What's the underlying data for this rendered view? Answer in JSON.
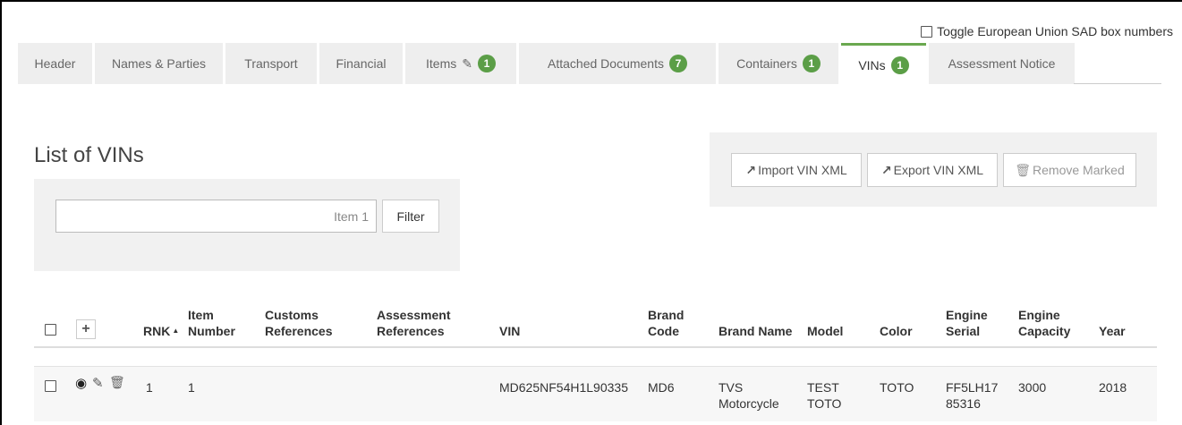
{
  "toggle": {
    "label": "Toggle European Union SAD box numbers"
  },
  "tabs": [
    {
      "label": "Header"
    },
    {
      "label": "Names & Parties"
    },
    {
      "label": "Transport"
    },
    {
      "label": "Financial"
    },
    {
      "label": "Items",
      "badge": "1",
      "icon": "edit-icon"
    },
    {
      "label": "Attached Documents",
      "badge": "7"
    },
    {
      "label": "Containers",
      "badge": "1"
    },
    {
      "label": "VINs",
      "badge": "1",
      "active": true
    },
    {
      "label": "Assessment Notice"
    }
  ],
  "list": {
    "title": "List of VINs",
    "filter_value": "Item 1",
    "filter_button": "Filter"
  },
  "actions": {
    "import_label": "Import VIN XML",
    "export_label": "Export VIN XML",
    "remove_label": "Remove Marked"
  },
  "table": {
    "headers": {
      "rnk": "RNK",
      "item_number_1": "Item",
      "item_number_2": "Number",
      "customs_1": "Customs",
      "customs_2": "References",
      "assessment_1": "Assessment",
      "assessment_2": "References",
      "vin": "VIN",
      "brand_code_1": "Brand",
      "brand_code_2": "Code",
      "brand_name": "Brand Name",
      "model": "Model",
      "color": "Color",
      "engine_serial_1": "Engine",
      "engine_serial_2": "Serial",
      "engine_capacity_1": "Engine",
      "engine_capacity_2": "Capacity",
      "year": "Year"
    },
    "rows": [
      {
        "rnk": "1",
        "item_number": "1",
        "customs_references": "",
        "assessment_references": "",
        "vin": "MD625NF54H1L90335",
        "brand_code": "MD6",
        "brand_name_1": "TVS",
        "brand_name_2": "Motorcycle",
        "model_1": "TEST",
        "model_2": "TOTO",
        "color": "TOTO",
        "engine_serial_1": "FF5LH17",
        "engine_serial_2": "85316",
        "engine_capacity": "3000",
        "year": "2018"
      }
    ]
  },
  "colors": {
    "accent": "#5b9e47",
    "tab_bg": "#eeeeee",
    "panel_bg": "#f1f1f1"
  }
}
